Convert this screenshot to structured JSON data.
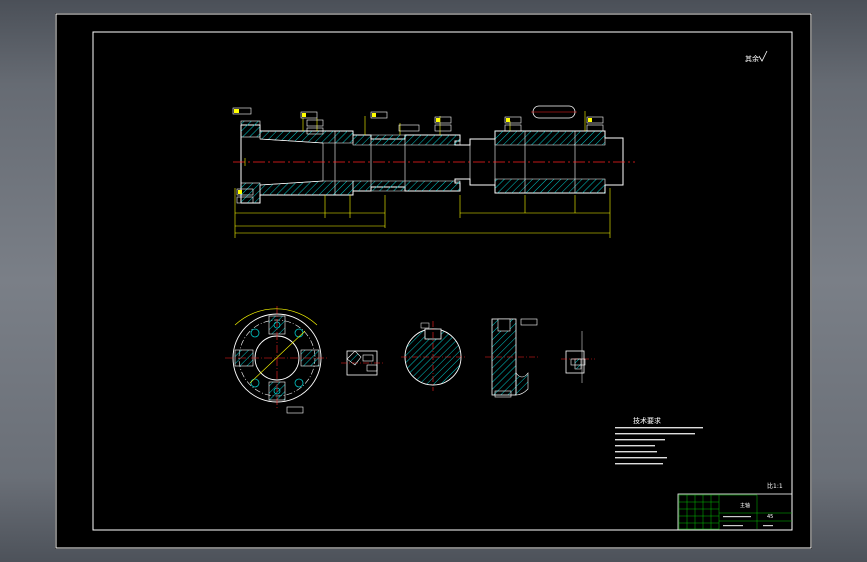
{
  "drawing": {
    "corner_note": "其余",
    "scale_note": "比1:1",
    "tech_requirements": {
      "heading": "技术要求"
    },
    "title_block": {
      "part_name": "主轴",
      "material": "45",
      "drawing_no": ""
    }
  },
  "colors": {
    "background": "#000000",
    "frame": "#ffffff",
    "centerline": "#ff2020",
    "dimension": "#ffff00",
    "hatch": "#00c8c8",
    "title_grid": "#00c000",
    "tolerance_box": "#ffffff"
  }
}
